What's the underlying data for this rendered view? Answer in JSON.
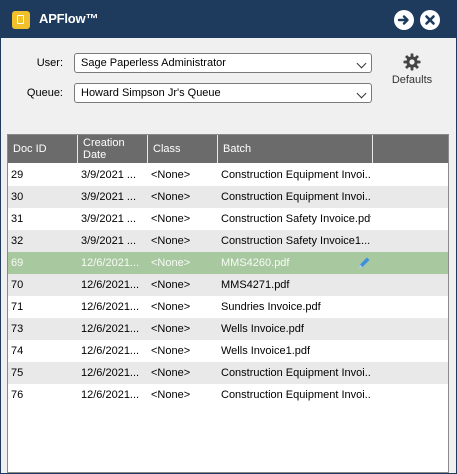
{
  "window": {
    "title": "APFlow™",
    "buttons": [
      {
        "name": "forward-arrow-icon"
      },
      {
        "name": "close-icon"
      }
    ]
  },
  "form": {
    "user_label": "User:",
    "user_value": "Sage Paperless Administrator",
    "queue_label": "Queue:",
    "queue_value": "Howard Simpson Jr's Queue",
    "defaults_label": "Defaults"
  },
  "grid": {
    "columns": [
      "Doc ID",
      "Creation Date",
      "Class",
      "Batch"
    ],
    "column_lines": [
      [
        "Doc ID"
      ],
      [
        "Creation",
        "Date"
      ],
      [
        "Class"
      ],
      [
        "Batch"
      ]
    ],
    "selected_row": 4,
    "rows": [
      {
        "doc_id": "29",
        "date": "3/9/2021 ...",
        "class": "<None>",
        "batch": "Construction Equipment Invoi..."
      },
      {
        "doc_id": "30",
        "date": "3/9/2021 ...",
        "class": "<None>",
        "batch": "Construction Equipment Invoi..."
      },
      {
        "doc_id": "31",
        "date": "3/9/2021 ...",
        "class": "<None>",
        "batch": "Construction Safety Invoice.pdf"
      },
      {
        "doc_id": "32",
        "date": "3/9/2021 ...",
        "class": "<None>",
        "batch": "Construction Safety Invoice1...."
      },
      {
        "doc_id": "69",
        "date": "12/6/2021...",
        "class": "<None>",
        "batch": "MMS4260.pdf"
      },
      {
        "doc_id": "70",
        "date": "12/6/2021...",
        "class": "<None>",
        "batch": "MMS4271.pdf"
      },
      {
        "doc_id": "71",
        "date": "12/6/2021...",
        "class": "<None>",
        "batch": "Sundries Invoice.pdf"
      },
      {
        "doc_id": "73",
        "date": "12/6/2021...",
        "class": "<None>",
        "batch": "Wells Invoice.pdf"
      },
      {
        "doc_id": "74",
        "date": "12/6/2021...",
        "class": "<None>",
        "batch": "Wells Invoice1.pdf"
      },
      {
        "doc_id": "75",
        "date": "12/6/2021...",
        "class": "<None>",
        "batch": "Construction Equipment Invoi..."
      },
      {
        "doc_id": "76",
        "date": "12/6/2021...",
        "class": "<None>",
        "batch": "Construction Equipment Invoi..."
      }
    ]
  },
  "colors": {
    "titlebar": "#1e3a5c",
    "header": "#6b6b6b",
    "selected_row": "#a8c8a0",
    "alt_row": "#e9e9e9",
    "edit_icon": "#3d8fe0"
  }
}
